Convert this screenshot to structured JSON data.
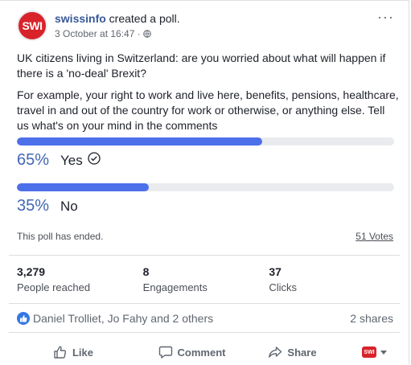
{
  "header": {
    "avatar_text": "SWI",
    "page_name": "swissinfo",
    "action_text": " created a poll.",
    "timestamp": "3 October at 16:47 ·",
    "more_label": "···"
  },
  "post": {
    "question": "UK citizens living in Switzerland: are you worried about what will happen if there is a 'no-deal' Brexit?",
    "body": "For example, your right to work and live here, benefits, pensions, healthcare, travel in and out of the country for work or otherwise, or anything else. Tell us what's on your mind in the comments"
  },
  "poll": {
    "options": [
      {
        "percent_label": "65%",
        "label": "Yes",
        "fill": 0.65,
        "selected": true
      },
      {
        "percent_label": "35%",
        "label": "No",
        "fill": 0.35,
        "selected": false
      }
    ],
    "status": "This poll has ended.",
    "votes": "51 Votes"
  },
  "stats": [
    {
      "value": "3,279",
      "label": "People reached"
    },
    {
      "value": "8",
      "label": "Engagements"
    },
    {
      "value": "37",
      "label": "Clicks"
    }
  ],
  "reactions": {
    "names": "Daniel Trolliet, Jo Fahy and 2 others",
    "shares": "2 shares"
  },
  "actions": {
    "like": "Like",
    "comment": "Comment",
    "share": "Share",
    "as_avatar_text": "SWI"
  },
  "colors": {
    "bar_fill": "#4c6fea",
    "percent": "#4267b2",
    "brand": "#d8232a",
    "link": "#385898"
  }
}
